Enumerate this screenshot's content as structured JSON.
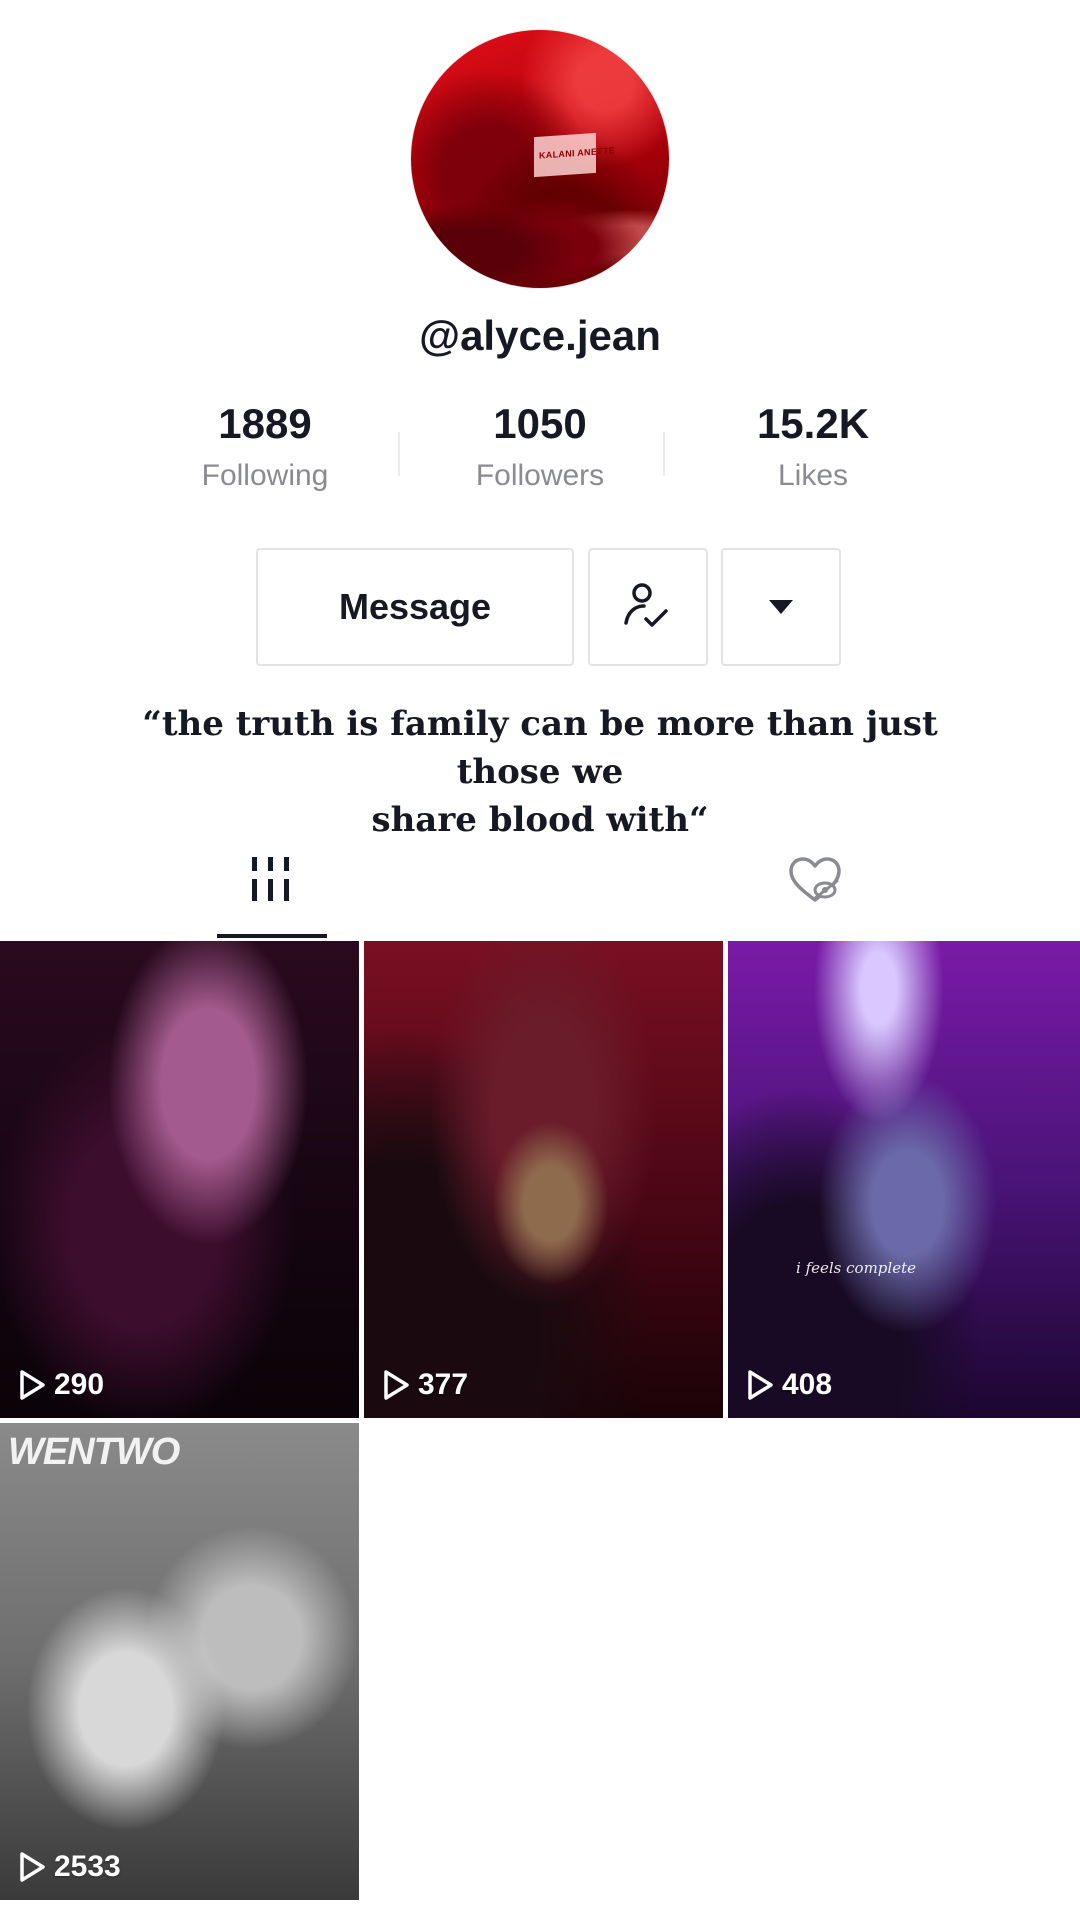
{
  "profile": {
    "username": "@alyce.jean",
    "avatar_sign_text": "KALANI ANETTE"
  },
  "stats": {
    "following": {
      "value": "1889",
      "label": "Following"
    },
    "followers": {
      "value": "1050",
      "label": "Followers"
    },
    "likes": {
      "value": "15.2K",
      "label": "Likes"
    }
  },
  "actions": {
    "message_label": "Message",
    "follow_icon": "user-check-icon",
    "more_icon": "caret-down-icon"
  },
  "bio": {
    "line1": "“the truth is family can be more than just those we",
    "line2": "share blood with“"
  },
  "tabs": [
    {
      "name": "videos",
      "icon": "grid-bars-icon",
      "active": true
    },
    {
      "name": "liked",
      "icon": "hidden-heart-icon",
      "active": false
    }
  ],
  "videos": [
    {
      "views": "290"
    },
    {
      "views": "377"
    },
    {
      "views": "408",
      "overlay_text": "i feels complete"
    },
    {
      "views": "2533",
      "poster_title": "WENTWO"
    }
  ]
}
